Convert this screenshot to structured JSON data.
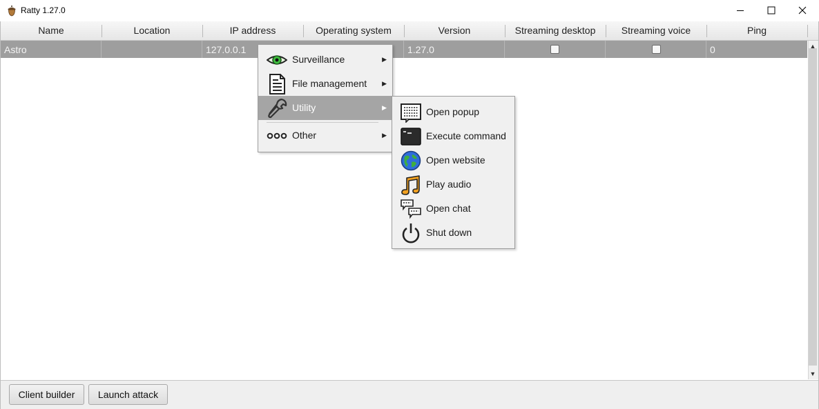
{
  "window": {
    "title": "Ratty 1.27.0",
    "controls": {
      "minimize": "minimize-icon",
      "maximize": "maximize-icon",
      "close": "close-icon"
    }
  },
  "table": {
    "columns": [
      "Name",
      "Location",
      "IP address",
      "Operating system",
      "Version",
      "Streaming desktop",
      "Streaming voice",
      "Ping"
    ],
    "rows": [
      {
        "name": "Astro",
        "location": "",
        "ip": "127.0.0.1",
        "os": "",
        "version": "1.27.0",
        "streaming_desktop": false,
        "streaming_voice": false,
        "ping": "0"
      }
    ]
  },
  "context_menu": {
    "items": [
      {
        "label": "Surveillance",
        "icon": "eye-icon"
      },
      {
        "label": "File management",
        "icon": "document-icon"
      },
      {
        "label": "Utility",
        "icon": "wrench-icon",
        "selected": true
      },
      {
        "label": "Other",
        "icon": "dots-icon"
      }
    ],
    "submenu": [
      {
        "label": "Open popup",
        "icon": "popup-icon"
      },
      {
        "label": "Execute command",
        "icon": "terminal-icon"
      },
      {
        "label": "Open website",
        "icon": "globe-icon"
      },
      {
        "label": "Play audio",
        "icon": "music-note-icon"
      },
      {
        "label": "Open chat",
        "icon": "chat-icon"
      },
      {
        "label": "Shut down",
        "icon": "power-icon"
      }
    ]
  },
  "bottom_bar": {
    "client_builder": "Client builder",
    "launch_attack": "Launch attack"
  },
  "colors": {
    "selected_row": "#9e9e9e",
    "menu_bg": "#f0f0f0",
    "menu_selected": "#a5a5a5",
    "eye_green": "#3fbf3f",
    "globe_blue": "#2f6ddb",
    "music_orange": "#f0a020"
  }
}
